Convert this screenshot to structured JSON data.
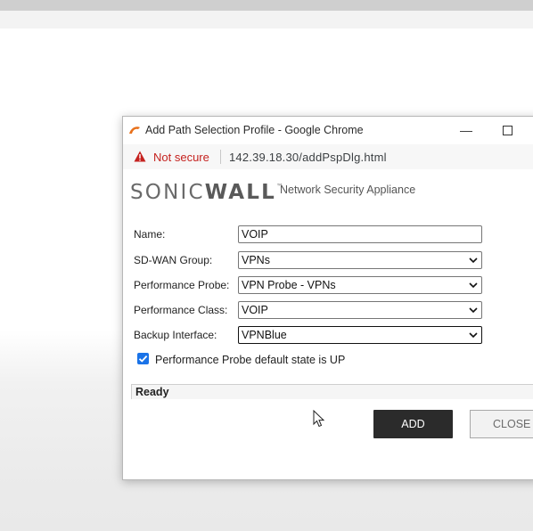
{
  "window": {
    "title": "Add Path Selection Profile - Google Chrome",
    "minimize_glyph": "—"
  },
  "address": {
    "security_label": "Not secure",
    "url": "142.39.18.30/addPspDlg.html"
  },
  "brand": {
    "logo_left": "SONIC",
    "logo_right": "WALL",
    "logo_tm": "™",
    "product": "Network Security Appliance"
  },
  "form": {
    "name_label": "Name:",
    "name_value": "VOIP",
    "sdwan_label": "SD-WAN Group:",
    "sdwan_value": "VPNs",
    "probe_label": "Performance Probe:",
    "probe_value": "VPN Probe - VPNs",
    "class_label": "Performance Class:",
    "class_value": "VOIP",
    "backup_label": "Backup Interface:",
    "backup_value": "VPNBlue",
    "checkbox_label": "Performance Probe default state is UP",
    "checkbox_checked": true
  },
  "status": {
    "text": "Ready"
  },
  "buttons": {
    "add": "ADD",
    "close": "CLOSE"
  },
  "colors": {
    "accent": "#1a73e8",
    "warning": "#c5221f",
    "add_button_bg": "#2b2b2b"
  }
}
